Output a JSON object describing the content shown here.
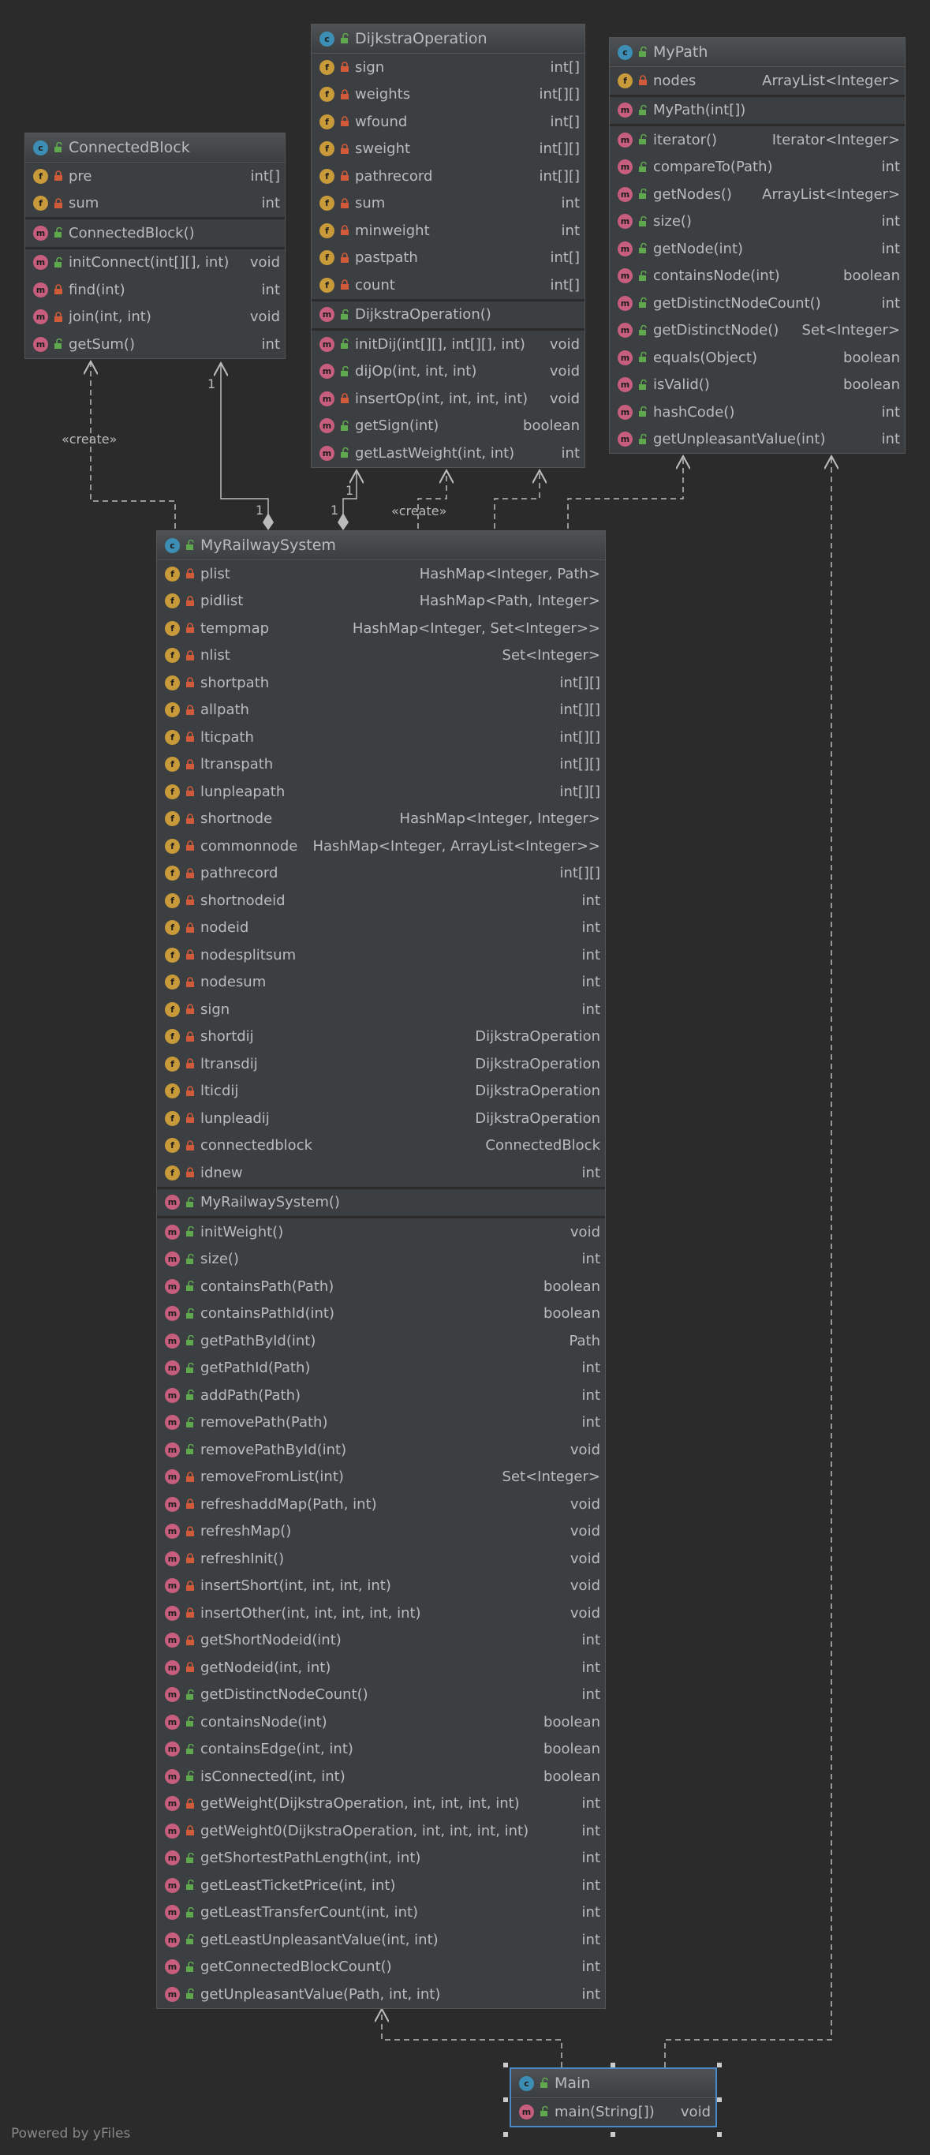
{
  "footer": "Powered by yFiles",
  "relations": {
    "create_label": "«create»",
    "multiplicity": "1"
  },
  "classes": {
    "connected": {
      "name": "ConnectedBlock",
      "fields": [
        {
          "name": "pre",
          "type": "int[]",
          "vis": "private"
        },
        {
          "name": "sum",
          "type": "int",
          "vis": "private"
        }
      ],
      "constructors": [
        {
          "name": "ConnectedBlock()",
          "type": "",
          "vis": "public"
        }
      ],
      "methods": [
        {
          "name": "initConnect(int[][], int)",
          "type": "void",
          "vis": "public"
        },
        {
          "name": "find(int)",
          "type": "int",
          "vis": "private"
        },
        {
          "name": "join(int, int)",
          "type": "void",
          "vis": "private"
        },
        {
          "name": "getSum()",
          "type": "int",
          "vis": "public"
        }
      ]
    },
    "dijkstra": {
      "name": "DijkstraOperation",
      "fields": [
        {
          "name": "sign",
          "type": "int[]",
          "vis": "private"
        },
        {
          "name": "weights",
          "type": "int[][]",
          "vis": "private"
        },
        {
          "name": "wfound",
          "type": "int[]",
          "vis": "private"
        },
        {
          "name": "sweight",
          "type": "int[][]",
          "vis": "private"
        },
        {
          "name": "pathrecord",
          "type": "int[][]",
          "vis": "private"
        },
        {
          "name": "sum",
          "type": "int",
          "vis": "private"
        },
        {
          "name": "minweight",
          "type": "int",
          "vis": "private"
        },
        {
          "name": "pastpath",
          "type": "int[]",
          "vis": "private"
        },
        {
          "name": "count",
          "type": "int[]",
          "vis": "private"
        }
      ],
      "constructors": [
        {
          "name": "DijkstraOperation()",
          "type": "",
          "vis": "public"
        }
      ],
      "methods": [
        {
          "name": "initDij(int[][], int[][], int)",
          "type": "void",
          "vis": "public"
        },
        {
          "name": "dijOp(int, int, int)",
          "type": "void",
          "vis": "public"
        },
        {
          "name": "insertOp(int, int, int, int)",
          "type": "void",
          "vis": "private"
        },
        {
          "name": "getSign(int)",
          "type": "boolean",
          "vis": "public"
        },
        {
          "name": "getLastWeight(int, int)",
          "type": "int",
          "vis": "public"
        }
      ]
    },
    "mypath": {
      "name": "MyPath",
      "fields": [
        {
          "name": "nodes",
          "type": "ArrayList<Integer>",
          "vis": "private"
        }
      ],
      "constructors": [
        {
          "name": "MyPath(int[])",
          "type": "",
          "vis": "public"
        }
      ],
      "methods": [
        {
          "name": "iterator()",
          "type": "Iterator<Integer>",
          "vis": "public"
        },
        {
          "name": "compareTo(Path)",
          "type": "int",
          "vis": "public"
        },
        {
          "name": "getNodes()",
          "type": "ArrayList<Integer>",
          "vis": "public"
        },
        {
          "name": "size()",
          "type": "int",
          "vis": "public"
        },
        {
          "name": "getNode(int)",
          "type": "int",
          "vis": "public"
        },
        {
          "name": "containsNode(int)",
          "type": "boolean",
          "vis": "public"
        },
        {
          "name": "getDistinctNodeCount()",
          "type": "int",
          "vis": "public"
        },
        {
          "name": "getDistinctNode()",
          "type": "Set<Integer>",
          "vis": "public"
        },
        {
          "name": "equals(Object)",
          "type": "boolean",
          "vis": "public"
        },
        {
          "name": "isValid()",
          "type": "boolean",
          "vis": "public"
        },
        {
          "name": "hashCode()",
          "type": "int",
          "vis": "public"
        },
        {
          "name": "getUnpleasantValue(int)",
          "type": "int",
          "vis": "public"
        }
      ]
    },
    "railway": {
      "name": "MyRailwaySystem",
      "fields": [
        {
          "name": "plist",
          "type": "HashMap<Integer, Path>",
          "vis": "private"
        },
        {
          "name": "pidlist",
          "type": "HashMap<Path, Integer>",
          "vis": "private"
        },
        {
          "name": "tempmap",
          "type": "HashMap<Integer, Set<Integer>>",
          "vis": "private"
        },
        {
          "name": "nlist",
          "type": "Set<Integer>",
          "vis": "private"
        },
        {
          "name": "shortpath",
          "type": "int[][]",
          "vis": "private"
        },
        {
          "name": "allpath",
          "type": "int[][]",
          "vis": "private"
        },
        {
          "name": "lticpath",
          "type": "int[][]",
          "vis": "private"
        },
        {
          "name": "ltranspath",
          "type": "int[][]",
          "vis": "private"
        },
        {
          "name": "lunpleapath",
          "type": "int[][]",
          "vis": "private"
        },
        {
          "name": "shortnode",
          "type": "HashMap<Integer, Integer>",
          "vis": "private"
        },
        {
          "name": "commonnode",
          "type": "HashMap<Integer, ArrayList<Integer>>",
          "vis": "private"
        },
        {
          "name": "pathrecord",
          "type": "int[][]",
          "vis": "private"
        },
        {
          "name": "shortnodeid",
          "type": "int",
          "vis": "private"
        },
        {
          "name": "nodeid",
          "type": "int",
          "vis": "private"
        },
        {
          "name": "nodesplitsum",
          "type": "int",
          "vis": "private"
        },
        {
          "name": "nodesum",
          "type": "int",
          "vis": "private"
        },
        {
          "name": "sign",
          "type": "int",
          "vis": "private"
        },
        {
          "name": "shortdij",
          "type": "DijkstraOperation",
          "vis": "private"
        },
        {
          "name": "ltransdij",
          "type": "DijkstraOperation",
          "vis": "private"
        },
        {
          "name": "lticdij",
          "type": "DijkstraOperation",
          "vis": "private"
        },
        {
          "name": "lunpleadij",
          "type": "DijkstraOperation",
          "vis": "private"
        },
        {
          "name": "connectedblock",
          "type": "ConnectedBlock",
          "vis": "private"
        },
        {
          "name": "idnew",
          "type": "int",
          "vis": "private"
        }
      ],
      "constructors": [
        {
          "name": "MyRailwaySystem()",
          "type": "",
          "vis": "public"
        }
      ],
      "methods": [
        {
          "name": "initWeight()",
          "type": "void",
          "vis": "public"
        },
        {
          "name": "size()",
          "type": "int",
          "vis": "public"
        },
        {
          "name": "containsPath(Path)",
          "type": "boolean",
          "vis": "public"
        },
        {
          "name": "containsPathId(int)",
          "type": "boolean",
          "vis": "public"
        },
        {
          "name": "getPathById(int)",
          "type": "Path",
          "vis": "public"
        },
        {
          "name": "getPathId(Path)",
          "type": "int",
          "vis": "public"
        },
        {
          "name": "addPath(Path)",
          "type": "int",
          "vis": "public"
        },
        {
          "name": "removePath(Path)",
          "type": "int",
          "vis": "public"
        },
        {
          "name": "removePathById(int)",
          "type": "void",
          "vis": "public"
        },
        {
          "name": "removeFromList(int)",
          "type": "Set<Integer>",
          "vis": "private"
        },
        {
          "name": "refreshaddMap(Path, int)",
          "type": "void",
          "vis": "private"
        },
        {
          "name": "refreshMap()",
          "type": "void",
          "vis": "private"
        },
        {
          "name": "refreshInit()",
          "type": "void",
          "vis": "private"
        },
        {
          "name": "insertShort(int, int, int, int)",
          "type": "void",
          "vis": "private"
        },
        {
          "name": "insertOther(int, int, int, int, int)",
          "type": "void",
          "vis": "private"
        },
        {
          "name": "getShortNodeid(int)",
          "type": "int",
          "vis": "private"
        },
        {
          "name": "getNodeid(int, int)",
          "type": "int",
          "vis": "private"
        },
        {
          "name": "getDistinctNodeCount()",
          "type": "int",
          "vis": "public"
        },
        {
          "name": "containsNode(int)",
          "type": "boolean",
          "vis": "public"
        },
        {
          "name": "containsEdge(int, int)",
          "type": "boolean",
          "vis": "public"
        },
        {
          "name": "isConnected(int, int)",
          "type": "boolean",
          "vis": "public"
        },
        {
          "name": "getWeight(DijkstraOperation, int, int, int, int)",
          "type": "int",
          "vis": "private"
        },
        {
          "name": "getWeight0(DijkstraOperation, int, int, int, int)",
          "type": "int",
          "vis": "private"
        },
        {
          "name": "getShortestPathLength(int, int)",
          "type": "int",
          "vis": "public"
        },
        {
          "name": "getLeastTicketPrice(int, int)",
          "type": "int",
          "vis": "public"
        },
        {
          "name": "getLeastTransferCount(int, int)",
          "type": "int",
          "vis": "public"
        },
        {
          "name": "getLeastUnpleasantValue(int, int)",
          "type": "int",
          "vis": "public"
        },
        {
          "name": "getConnectedBlockCount()",
          "type": "int",
          "vis": "public"
        },
        {
          "name": "getUnpleasantValue(Path, int, int)",
          "type": "int",
          "vis": "public"
        }
      ]
    },
    "main": {
      "name": "Main",
      "fields": [],
      "constructors": [],
      "methods": [
        {
          "name": "main(String[])",
          "type": "void",
          "vis": "public"
        }
      ]
    }
  },
  "colors": {
    "background": "#2b2b2b",
    "box": "#3c3f41",
    "class_icon": "#3d8eb5",
    "field_icon": "#c89a3a",
    "method_icon": "#c85e7d",
    "public_lock": "#5fa84e",
    "private_lock": "#d05a3a",
    "selection": "#4a88c7"
  }
}
